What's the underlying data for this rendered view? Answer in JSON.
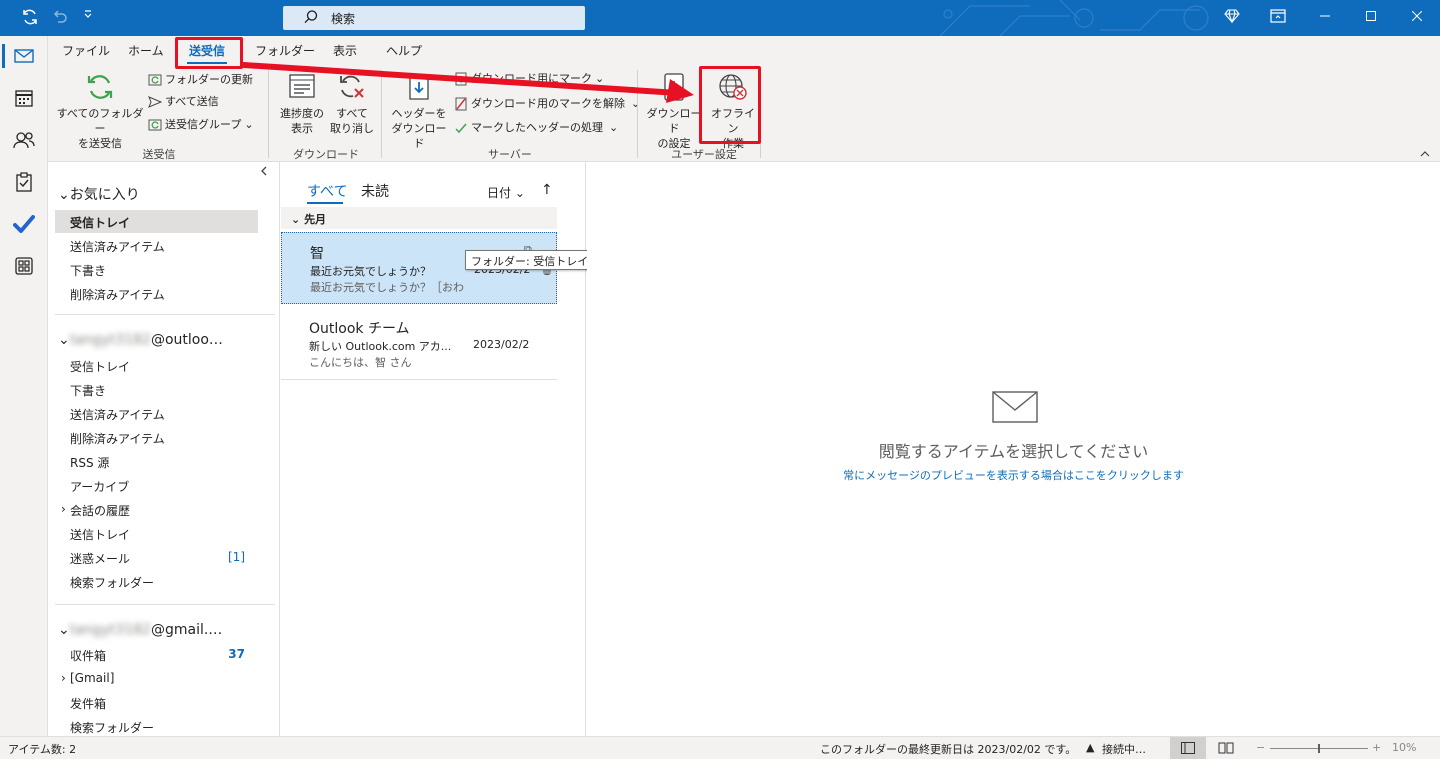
{
  "titlebar": {
    "search_placeholder": "検索"
  },
  "ribbon": {
    "tabs": [
      "ファイル",
      "ホーム",
      "送受信",
      "フォルダー",
      "表示",
      "ヘルプ"
    ],
    "active_tab": "送受信",
    "groups": {
      "sendreceive": {
        "label": "送受信",
        "big_button": "すべてのフォルダー\nを送受信",
        "refresh_folder": "フォルダーの更新",
        "send_all": "すべて送信",
        "sendreceive_groups": "送受信グループ"
      },
      "download": {
        "label": "ダウンロード",
        "progress": "進捗度の\n表示",
        "cancel_all": "すべて\n取り消し"
      },
      "server": {
        "label": "サーバー",
        "download_headers": "ヘッダーを\nダウンロード",
        "mark_download": "ダウンロード用にマーク",
        "unmark_download": "ダウンロード用のマークを解除",
        "process_marked": "マークしたヘッダーの処理"
      },
      "preferences": {
        "label": "ユーザー設定",
        "download_settings": "ダウンロード\nの設定",
        "work_offline": "オフライン\n作業"
      }
    }
  },
  "folder_pane": {
    "favorites_header": "お気に入り",
    "favorites": [
      "受信トレイ",
      "送信済みアイテム",
      "下書き",
      "削除済みアイテム"
    ],
    "account1": {
      "name_blurred": "tangyt3182",
      "name_suffix": "@outloo…",
      "folders": [
        "受信トレイ",
        "下書き",
        "送信済みアイテム",
        "削除済みアイテム",
        "RSS 源",
        "アーカイブ",
        "会話の履歴",
        "送信トレイ",
        "迷惑メール",
        "検索フォルダー"
      ],
      "junk_count": "[1]"
    },
    "account2": {
      "name_blurred": "tangyt3182",
      "name_suffix": "@gmail.…",
      "folders": [
        "収件箱",
        "[Gmail]",
        "发件箱",
        "検索フォルダー"
      ],
      "inbox_count": "37"
    }
  },
  "message_list": {
    "filter_all": "すべて",
    "filter_unread": "未読",
    "sort_label": "日付",
    "group_header": "先月",
    "messages": [
      {
        "sender": "智",
        "subject": "最近お元気でしょうか？",
        "preview": "最近お元気でしょうか？［おわ",
        "date": "2023/02/2",
        "selected": true
      },
      {
        "sender": "Outlook チーム",
        "subject": "新しい Outlook.com アカ...",
        "preview": "こんにちは、智 さん",
        "date": "2023/02/2",
        "selected": false
      }
    ],
    "tooltip": "フォルダー: 受信トレイ"
  },
  "reading_pane": {
    "message": "閲覧するアイテムを選択してください",
    "link": "常にメッセージのプレビューを表示する場合はここをクリックします"
  },
  "status_bar": {
    "item_count": "アイテム数: 2",
    "last_updated": "このフォルダーの最終更新日は 2023/02/02 です。",
    "connection": "接続中…",
    "zoom": "10%"
  },
  "colors": {
    "accent": "#0f6cbd",
    "annotation_red": "#e81123",
    "selected_row": "#cce4f7"
  }
}
